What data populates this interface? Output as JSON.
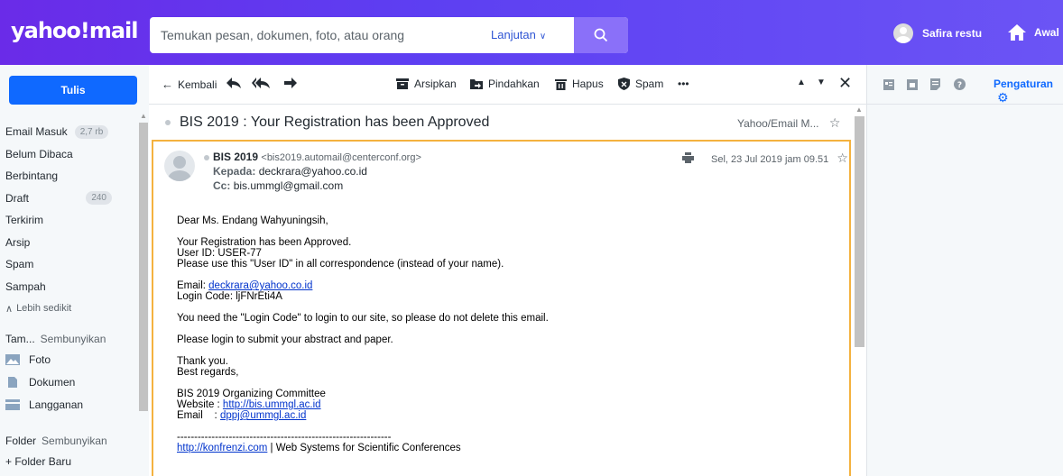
{
  "header": {
    "logo": "yahoo!mail",
    "search_placeholder": "Temukan pesan, dokumen, foto, atau orang",
    "advanced_label": "Lanjutan",
    "user_name": "Safira restu",
    "home_label": "Awal",
    "brand_color": "#6001d2"
  },
  "sidebar": {
    "compose_label": "Tulis",
    "folders": [
      {
        "label": "Email Masuk",
        "badge": "2,7 rb"
      },
      {
        "label": "Belum Dibaca"
      },
      {
        "label": "Berbintang"
      },
      {
        "label": "Draft",
        "badge": "240"
      },
      {
        "label": "Terkirim"
      },
      {
        "label": "Arsip"
      },
      {
        "label": "Spam"
      },
      {
        "label": "Sampah"
      }
    ],
    "less_label": "Lebih sedikit",
    "views_title": "Tam...",
    "views_hide": "Sembunyikan",
    "views": [
      "Foto",
      "Dokumen",
      "Langganan"
    ],
    "folder_title": "Folder",
    "folder_hide": "Sembunyikan",
    "new_folder": "+ Folder Baru"
  },
  "toolbar": {
    "back": "Kembali",
    "archive": "Arsipkan",
    "move": "Pindahkan",
    "delete": "Hapus",
    "spam": "Spam",
    "more": "•••"
  },
  "right_pane": {
    "settings_label": "Pengaturan"
  },
  "message": {
    "subject": "BIS 2019 : Your Registration has been Approved",
    "folder_tag": "Yahoo/Email M...",
    "sender_name": "BIS 2019",
    "sender_email": "<bis2019.automail@centerconf.org>",
    "to_label": "Kepada:",
    "to_value": "deckrara@yahoo.co.id",
    "cc_label": "Cc:",
    "cc_value": "bis.ummgl@gmail.com",
    "date": "Sel, 23 Jul 2019 jam 09.51",
    "body": {
      "greeting": "Dear Ms. Endang Wahyuningsih,",
      "approved": "Your Registration has been Approved.",
      "user_id": "User ID: USER-77",
      "use_id": "Please use this \"User ID\" in all correspondence (instead of your name).",
      "email_label": "Email: ",
      "email_link": "deckrara@yahoo.co.id",
      "login_code": "Login Code: ljFNrEti4A",
      "need_code": "You need the \"Login Code\" to login to our site, so please do not delete this email.",
      "please_login": "Please login to submit your abstract and paper.",
      "thanks": "Thank you.",
      "regards": "Best regards,",
      "committee": "BIS 2019 Organizing Committee",
      "website_label": "Website : ",
      "website_link": "http://bis.ummgl.ac.id",
      "email2_label": "Email    : ",
      "email2_link": "dppj@ummgl.ac.id",
      "separator": "--------------------------------------------------------------",
      "footer_link": "http://konfrenzi.com",
      "footer_text": " | Web Systems for Scientific Conferences"
    }
  }
}
